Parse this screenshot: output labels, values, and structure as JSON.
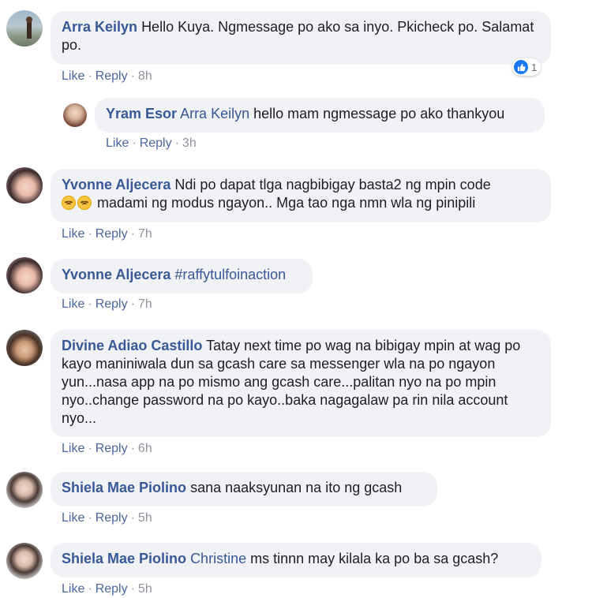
{
  "actions": {
    "like": "Like",
    "reply": "Reply",
    "separator": "·"
  },
  "comments": [
    {
      "author": "Arra Keilyn",
      "text": "Hello Kuya. Ngmessage po ako sa inyo. Pkicheck po. Salamat po.",
      "time": "8h",
      "reaction": {
        "icon": "like-icon",
        "count": "1"
      }
    },
    {
      "author": "Yram Esor",
      "mention": "Arra Keilyn",
      "text": "hello mam ngmessage po ako thankyou",
      "time": "3h",
      "is_reply": true
    },
    {
      "author": "Yvonne Aljecera",
      "text_part1": "Ndi po dapat tlga nagbibigay basta2 ng mpin code",
      "emojis": [
        "pensive-face-emoji",
        "pensive-face-emoji"
      ],
      "text_part2": "madami ng modus ngayon.. Mga tao nga nmn wla ng pinipili",
      "time": "7h"
    },
    {
      "author": "Yvonne Aljecera",
      "text": "#raffytulfoinaction",
      "time": "7h"
    },
    {
      "author": "Divine Adiao Castillo",
      "text": "Tatay next time po wag na bibigay mpin at wag po kayo maniniwala dun sa gcash care sa messenger wla na po ngayon yun...nasa app na po mismo ang gcash care...palitan nyo na po mpin nyo..change password na po kayo..baka nagagalaw pa rin nila account nyo...",
      "time": "6h"
    },
    {
      "author": "Shiela Mae Piolino",
      "text": "sana naaksyunan na ito ng gcash",
      "time": "5h"
    },
    {
      "author": "Shiela Mae Piolino",
      "mention": "Christine",
      "text": "ms tinnn may kilala ka po ba sa gcash?",
      "time": "5h"
    }
  ]
}
